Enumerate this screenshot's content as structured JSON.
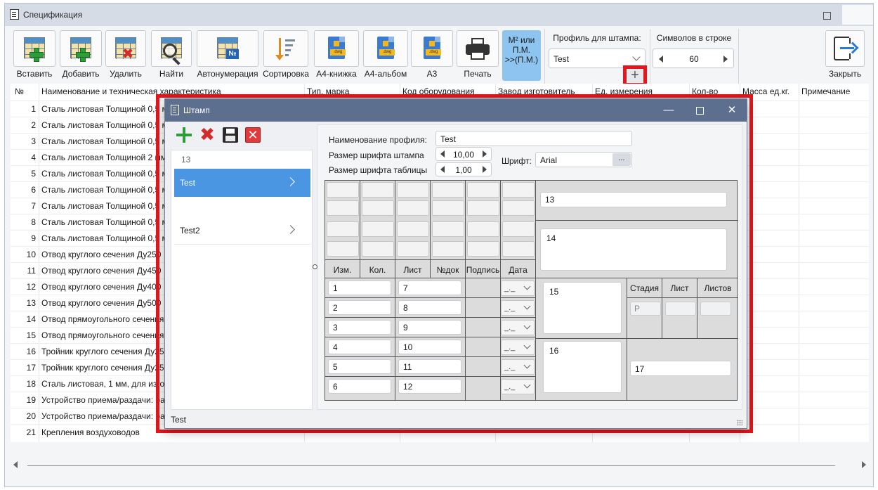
{
  "window": {
    "title": "Спецификация"
  },
  "toolbar": {
    "buttons": [
      {
        "label": "Вставить",
        "icon": "table-plus-icon"
      },
      {
        "label": "Добавить",
        "icon": "table-plus-icon"
      },
      {
        "label": "Удалить",
        "icon": "table-delete-icon"
      },
      {
        "label": "Найти",
        "icon": "table-search-icon"
      },
      {
        "label": "Автонумерация",
        "icon": "table-number-icon"
      },
      {
        "label": "Сортировка",
        "icon": "sort-icon"
      },
      {
        "label": "А4-книжка",
        "icon": "dwg-file-icon"
      },
      {
        "label": "А4-альбом",
        "icon": "dwg-file-icon"
      },
      {
        "label": "А3",
        "icon": "dwg-file-icon"
      },
      {
        "label": "Печать",
        "icon": "printer-icon"
      }
    ],
    "m2_button": {
      "line1": "M² или",
      "line2": "П.М.",
      "line3": ">>(П.М.)"
    },
    "profile_label": "Профиль для штампа:",
    "profile_value": "Test",
    "add_profile": "+",
    "symbols_label": "Символов в строке",
    "symbols_value": "60",
    "close_label": "Закрыть"
  },
  "table": {
    "headers": [
      "№",
      "Наименование и техническая характеристика",
      "Тип, марка",
      "Код оборудования",
      "Завод изготовитель",
      "Ед. измерения",
      "Кол-во",
      "Масса ед.кг.",
      "Примечание"
    ],
    "rows": [
      {
        "n": "1",
        "name": "Сталь листовая Толщиной 0,5 мм"
      },
      {
        "n": "2",
        "name": "Сталь листовая Толщиной 0,5 мм"
      },
      {
        "n": "3",
        "name": "Сталь листовая Толщиной 0,5 мм"
      },
      {
        "n": "4",
        "name": "Сталь листовая Толщиной 2 мм"
      },
      {
        "n": "5",
        "name": "Сталь листовая Толщиной 0,5 мм"
      },
      {
        "n": "6",
        "name": "Сталь листовая Толщиной 0,5 мм"
      },
      {
        "n": "7",
        "name": "Сталь листовая Толщиной 0,5 мм"
      },
      {
        "n": "8",
        "name": "Сталь листовая Толщиной 0,5 мм"
      },
      {
        "n": "9",
        "name": "Сталь листовая Толщиной 0,5 мм"
      },
      {
        "n": "10",
        "name": "Отвод круглого сечения Ду250"
      },
      {
        "n": "11",
        "name": "Отвод круглого сечения Ду450"
      },
      {
        "n": "12",
        "name": "Отвод круглого сечения Ду400"
      },
      {
        "n": "13",
        "name": "Отвод круглого сечения Ду500"
      },
      {
        "n": "14",
        "name": "Отвод прямоугольного сечения"
      },
      {
        "n": "15",
        "name": "Отвод прямоугольного сечения"
      },
      {
        "n": "16",
        "name": "Тройник круглого сечения Ду250"
      },
      {
        "n": "17",
        "name": "Тройник круглого сечения Ду250"
      },
      {
        "n": "18",
        "name": "Сталь листовая, 1 мм, для изготовления"
      },
      {
        "n": "19",
        "name": "Устройство приема/раздачи: ра"
      },
      {
        "n": "20",
        "name": "Устройство приема/раздачи: ра"
      },
      {
        "n": "21",
        "name": "Крепления воздуховодов"
      }
    ]
  },
  "dialog": {
    "title": "Штамп",
    "profile_count": "13",
    "profiles": [
      "Test",
      "Test2"
    ],
    "profile_name_label": "Наименование профиля:",
    "profile_name_value": "Test",
    "stamp_font_label": "Размер шрифта штампа",
    "stamp_font_value": "10,00",
    "table_font_label": "Размер шрифта таблицы",
    "table_font_value": "1,00",
    "font_label": "Шрифт:",
    "font_value": "Arial",
    "font_browse": "...",
    "stamp_headers": [
      "Изм.",
      "Кол.",
      "Лист",
      "№док",
      "Подпись",
      "Дата"
    ],
    "col1_values": [
      "1",
      "2",
      "3",
      "4",
      "5",
      "6"
    ],
    "col3_values": [
      "7",
      "8",
      "9",
      "10",
      "11",
      "12"
    ],
    "date_value": "_._",
    "field13": "13",
    "field14": "14",
    "field15": "15",
    "field16": "16",
    "field17": "17",
    "stage_headers": [
      "Стадия",
      "Лист",
      "Листов"
    ],
    "stage_value": "Р",
    "status_text": "Test"
  },
  "colors": {
    "highlight": "#e6161c",
    "dialog_title": "#5c6f8f",
    "selected": "#4a96e2"
  }
}
